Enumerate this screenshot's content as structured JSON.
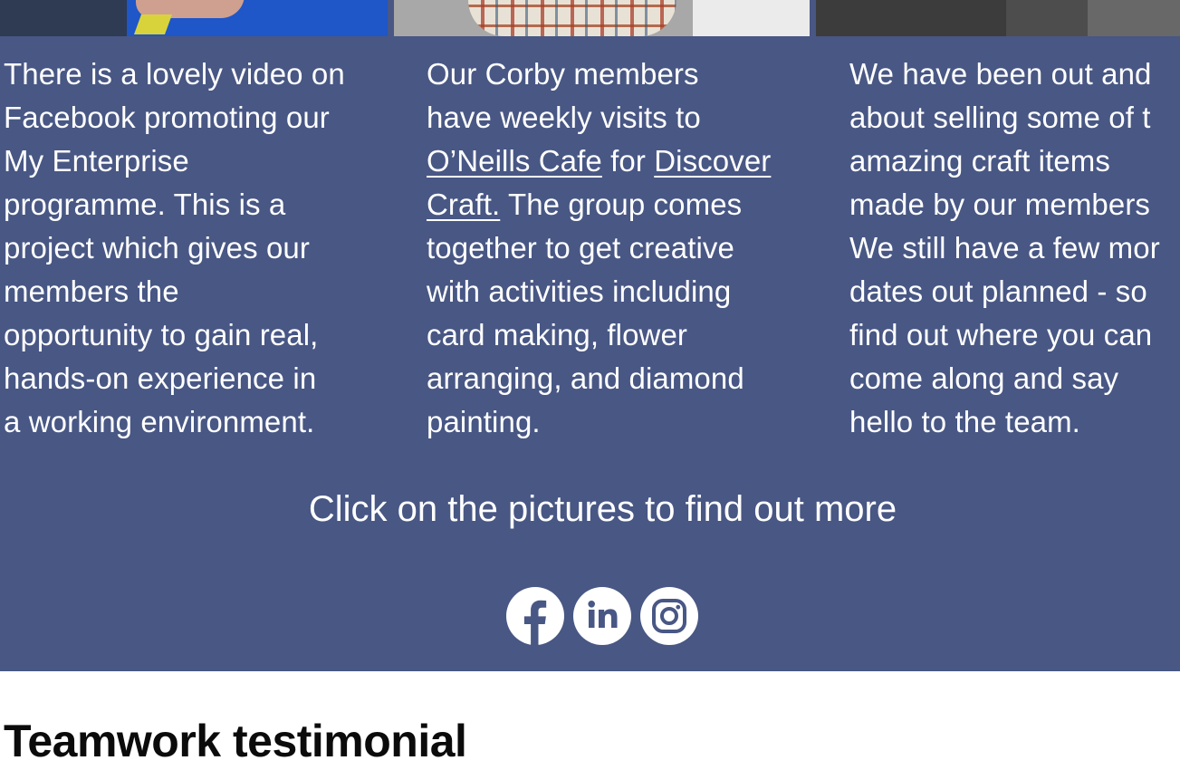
{
  "columns": [
    {
      "lines": [
        "There is a lovely video on",
        "Facebook promoting our",
        "My Enterprise",
        "programme. This is a",
        "project which gives our",
        "members the",
        "opportunity to gain real,",
        "hands-on experience in",
        "a working environment."
      ]
    },
    {
      "line1": "Our Corby members",
      "line2": "have weekly visits to",
      "link_cafe": "O’Neills Cafe",
      "word_for": " for ",
      "link_discover": "Discover",
      "link_craft": "Craft.",
      "line4_rest": " The group comes",
      "line5": "together to get creative",
      "line6": "with activities including",
      "line7": "card making, flower",
      "line8": "arranging, and diamond",
      "line9": "painting."
    },
    {
      "lines": [
        "We have been out and",
        "about selling some of t",
        "amazing craft items",
        "made by our members",
        "We still have a few mor",
        "dates out planned - so",
        "find out where you can",
        "come along and say",
        "hello to the team."
      ]
    }
  ],
  "cta_text": "Click on the pictures to find out more",
  "social": [
    {
      "icon": "facebook-icon"
    },
    {
      "icon": "linkedin-icon"
    },
    {
      "icon": "instagram-icon"
    }
  ],
  "section_heading": "Teamwork testimonial",
  "colors": {
    "section_bg": "#485784",
    "text_light": "#ffffff",
    "heading_text": "#0b0b0b",
    "page_bg": "#ffffff"
  }
}
